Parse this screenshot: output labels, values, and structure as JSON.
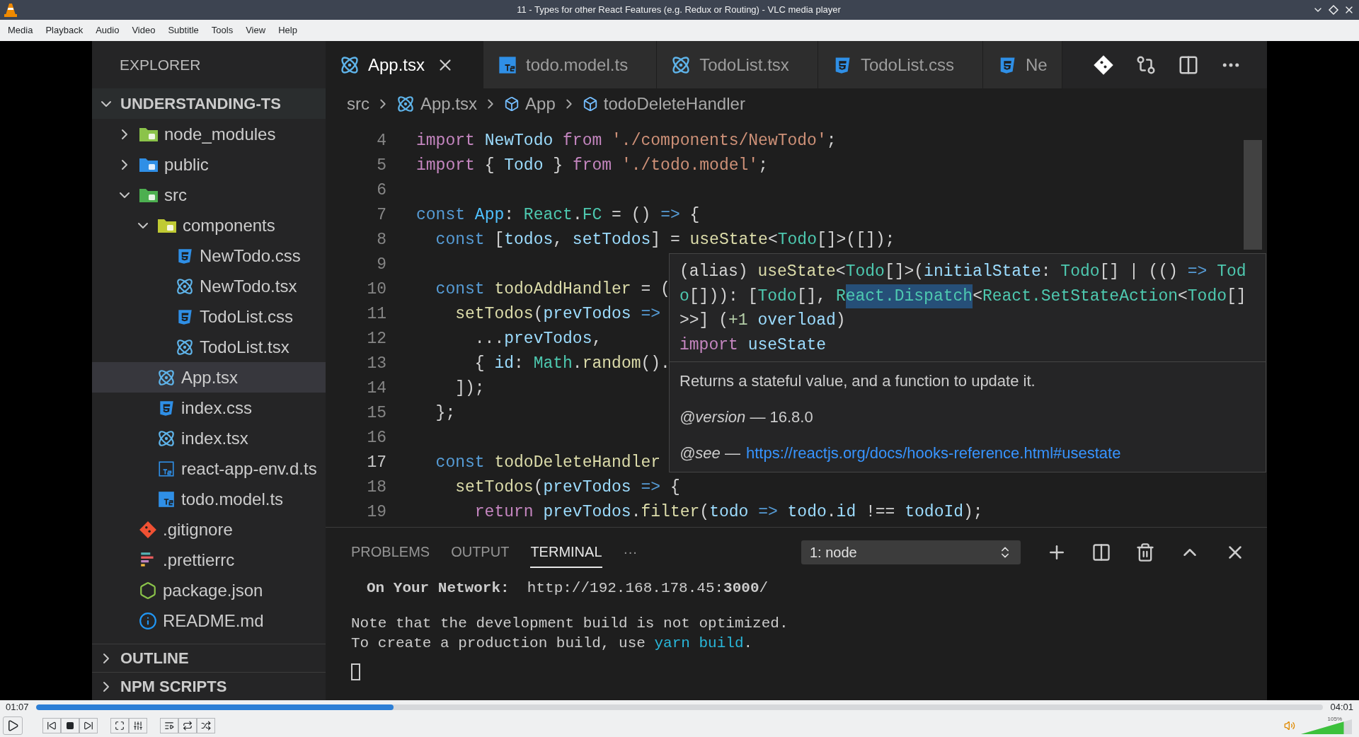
{
  "window": {
    "title": "11 - Types for other React Features (e.g. Redux or Routing) - VLC media player"
  },
  "menu": [
    "Media",
    "Playback",
    "Audio",
    "Video",
    "Subtitle",
    "Tools",
    "View",
    "Help"
  ],
  "editor": {
    "sidebar": {
      "title": "EXPLORER",
      "tree": [
        {
          "label": "UNDERSTANDING-TS",
          "kind": "root",
          "expanded": true,
          "selected": false,
          "children": [
            {
              "label": "node_modules",
              "kind": "folder-node",
              "expanded": false,
              "selected": false
            },
            {
              "label": "public",
              "kind": "folder-public",
              "expanded": false,
              "selected": false
            },
            {
              "label": "src",
              "kind": "folder-src",
              "expanded": true,
              "selected": false,
              "children": [
                {
                  "label": "components",
                  "kind": "folder-components",
                  "expanded": true,
                  "selected": false,
                  "children": [
                    {
                      "label": "NewTodo.css",
                      "kind": "css",
                      "selected": false
                    },
                    {
                      "label": "NewTodo.tsx",
                      "kind": "react",
                      "selected": false
                    },
                    {
                      "label": "TodoList.css",
                      "kind": "css",
                      "selected": false
                    },
                    {
                      "label": "TodoList.tsx",
                      "kind": "react",
                      "selected": false
                    }
                  ]
                },
                {
                  "label": "App.tsx",
                  "kind": "react",
                  "selected": true
                },
                {
                  "label": "index.css",
                  "kind": "css",
                  "selected": false
                },
                {
                  "label": "index.tsx",
                  "kind": "react",
                  "selected": false
                },
                {
                  "label": "react-app-env.d.ts",
                  "kind": "ts-outline",
                  "selected": false
                },
                {
                  "label": "todo.model.ts",
                  "kind": "ts",
                  "selected": false
                }
              ]
            },
            {
              "label": ".gitignore",
              "kind": "git",
              "selected": false
            },
            {
              "label": ".prettierrc",
              "kind": "prettier",
              "selected": false
            },
            {
              "label": "package.json",
              "kind": "json",
              "selected": false
            },
            {
              "label": "README.md",
              "kind": "info",
              "selected": false
            }
          ]
        }
      ],
      "sections": [
        {
          "label": "OUTLINE",
          "expanded": false
        },
        {
          "label": "NPM SCRIPTS",
          "expanded": false
        }
      ]
    },
    "tabs": [
      {
        "label": "App.tsx",
        "kind": "react",
        "selected": true
      },
      {
        "label": "todo.model.ts",
        "kind": "ts",
        "selected": false
      },
      {
        "label": "TodoList.tsx",
        "kind": "react",
        "selected": false
      },
      {
        "label": "TodoList.css",
        "kind": "css",
        "selected": false
      },
      {
        "label": "Ne",
        "kind": "css",
        "selected": false
      }
    ],
    "breadcrumb": [
      {
        "label": "src",
        "kind": "folder"
      },
      {
        "label": "App.tsx",
        "kind": "react"
      },
      {
        "label": "App",
        "kind": "symbol"
      },
      {
        "label": "todoDeleteHandler",
        "kind": "symbol"
      }
    ],
    "code_lines": [
      {
        "number": "4",
        "current": false,
        "tokens": [
          {
            "kind": "keyword",
            "text": "import "
          },
          {
            "kind": "variable",
            "text": "NewTodo "
          },
          {
            "kind": "keyword",
            "text": "from "
          },
          {
            "kind": "string",
            "text": "'./components/NewTodo'"
          },
          {
            "kind": "plain",
            "text": ";"
          }
        ]
      },
      {
        "number": "5",
        "current": false,
        "tokens": [
          {
            "kind": "keyword",
            "text": "import "
          },
          {
            "kind": "plain",
            "text": "{ "
          },
          {
            "kind": "variable",
            "text": "Todo"
          },
          {
            "kind": "plain",
            "text": " } "
          },
          {
            "kind": "keyword",
            "text": "from "
          },
          {
            "kind": "string",
            "text": "'./todo.model'"
          },
          {
            "kind": "plain",
            "text": ";"
          }
        ]
      },
      {
        "number": "6",
        "current": false
      },
      {
        "number": "7",
        "current": false,
        "tokens": [
          {
            "kind": "storage",
            "text": "const "
          },
          {
            "kind": "constant",
            "text": "App"
          },
          {
            "kind": "plain",
            "text": ": "
          },
          {
            "kind": "type",
            "text": "React"
          },
          {
            "kind": "plain",
            "text": "."
          },
          {
            "kind": "type",
            "text": "FC"
          },
          {
            "kind": "plain",
            "text": " = () "
          },
          {
            "kind": "storage",
            "text": "=>"
          },
          {
            "kind": "plain",
            "text": " {"
          }
        ]
      },
      {
        "number": "8",
        "current": false,
        "tokens": [
          {
            "kind": "storage",
            "text": "  const "
          },
          {
            "kind": "plain",
            "text": "["
          },
          {
            "kind": "variable",
            "text": "todos"
          },
          {
            "kind": "plain",
            "text": ", "
          },
          {
            "kind": "variable",
            "text": "setTodos"
          },
          {
            "kind": "plain",
            "text": "] = "
          },
          {
            "kind": "function",
            "text": "useState"
          },
          {
            "kind": "plain",
            "text": "<"
          },
          {
            "kind": "type",
            "text": "Todo"
          },
          {
            "kind": "plain",
            "text": "[]>([]);"
          }
        ]
      },
      {
        "number": "9",
        "current": false
      },
      {
        "number": "10",
        "current": false,
        "tokens": [
          {
            "kind": "storage",
            "text": "  const "
          },
          {
            "kind": "function",
            "text": "todoAddHandler"
          },
          {
            "kind": "plain",
            "text": " = ("
          }
        ]
      },
      {
        "number": "11",
        "current": false,
        "tokens": [
          {
            "kind": "function",
            "text": "    setTodos"
          },
          {
            "kind": "plain",
            "text": "("
          },
          {
            "kind": "variable",
            "text": "prevTodos"
          },
          {
            "kind": "storage",
            "text": " =>"
          }
        ]
      },
      {
        "number": "12",
        "current": false,
        "tokens": [
          {
            "kind": "plain",
            "text": "      ..."
          },
          {
            "kind": "variable",
            "text": "prevTodos"
          },
          {
            "kind": "plain",
            "text": ","
          }
        ]
      },
      {
        "number": "13",
        "current": false,
        "tokens": [
          {
            "kind": "plain",
            "text": "      { "
          },
          {
            "kind": "variable",
            "text": "id"
          },
          {
            "kind": "plain",
            "text": ": "
          },
          {
            "kind": "type",
            "text": "Math"
          },
          {
            "kind": "plain",
            "text": "."
          },
          {
            "kind": "function",
            "text": "random"
          },
          {
            "kind": "plain",
            "text": "()."
          }
        ]
      },
      {
        "number": "14",
        "current": false,
        "tokens": [
          {
            "kind": "plain",
            "text": "    ]);"
          }
        ]
      },
      {
        "number": "15",
        "current": false,
        "tokens": [
          {
            "kind": "plain",
            "text": "  };"
          }
        ]
      },
      {
        "number": "16",
        "current": false
      },
      {
        "number": "17",
        "current": true,
        "tokens": [
          {
            "kind": "storage",
            "text": "  const "
          },
          {
            "kind": "function",
            "text": "todoDeleteHandler"
          }
        ]
      },
      {
        "number": "18",
        "current": false,
        "tokens": [
          {
            "kind": "function",
            "text": "    setTodos"
          },
          {
            "kind": "plain",
            "text": "("
          },
          {
            "kind": "variable",
            "text": "prevTodos"
          },
          {
            "kind": "storage",
            "text": " =>"
          },
          {
            "kind": "plain",
            "text": " {"
          }
        ]
      },
      {
        "number": "19",
        "current": false,
        "tokens": [
          {
            "kind": "keyword",
            "text": "      return "
          },
          {
            "kind": "variable",
            "text": "prevTodos"
          },
          {
            "kind": "plain",
            "text": "."
          },
          {
            "kind": "function",
            "text": "filter"
          },
          {
            "kind": "plain",
            "text": "("
          },
          {
            "kind": "variable",
            "text": "todo"
          },
          {
            "kind": "storage",
            "text": " =>"
          },
          {
            "kind": "variable",
            "text": " todo"
          },
          {
            "kind": "plain",
            "text": "."
          },
          {
            "kind": "variable",
            "text": "id"
          },
          {
            "kind": "plain",
            "text": " !== "
          },
          {
            "kind": "variable",
            "text": "todoId"
          },
          {
            "kind": "plain",
            "text": ");"
          }
        ]
      }
    ],
    "hover": {
      "signature_lines": [
        [
          {
            "kind": "plain",
            "text": "(alias) ",
            "highlighted": false
          },
          {
            "kind": "function",
            "text": "useState",
            "highlighted": false
          },
          {
            "kind": "plain",
            "text": "<",
            "highlighted": false
          },
          {
            "kind": "type",
            "text": "Todo",
            "highlighted": false
          },
          {
            "kind": "plain",
            "text": "[]>(",
            "highlighted": false
          },
          {
            "kind": "variable",
            "text": "initialState",
            "highlighted": false
          },
          {
            "kind": "plain",
            "text": ": ",
            "highlighted": false
          },
          {
            "kind": "type",
            "text": "Todo",
            "highlighted": false
          },
          {
            "kind": "plain",
            "text": "[] | (() ",
            "highlighted": false
          },
          {
            "kind": "storage",
            "text": "=>",
            "highlighted": false
          },
          {
            "kind": "type",
            "text": " Tod",
            "highlighted": false
          }
        ],
        [
          {
            "kind": "type",
            "text": "o",
            "highlighted": false
          },
          {
            "kind": "plain",
            "text": "[])): [",
            "highlighted": false
          },
          {
            "kind": "type",
            "text": "Todo",
            "highlighted": false
          },
          {
            "kind": "plain",
            "text": "[], ",
            "highlighted": false
          },
          {
            "kind": "type",
            "text": "R",
            "highlighted": false
          },
          {
            "kind": "type",
            "text": "eact.Dispatch",
            "highlighted": true
          },
          {
            "kind": "plain",
            "text": "<",
            "highlighted": false
          },
          {
            "kind": "type",
            "text": "React.SetStateAction",
            "highlighted": false
          },
          {
            "kind": "plain",
            "text": "<",
            "highlighted": false
          },
          {
            "kind": "type",
            "text": "Todo",
            "highlighted": false
          },
          {
            "kind": "plain",
            "text": "[]",
            "highlighted": false
          }
        ],
        [
          {
            "kind": "plain",
            "text": ">>] (",
            "highlighted": false
          },
          {
            "kind": "number",
            "text": "+1",
            "highlighted": false
          },
          {
            "kind": "variable",
            "text": " overload",
            "highlighted": false
          },
          {
            "kind": "plain",
            "text": ")",
            "highlighted": false
          }
        ],
        [
          {
            "kind": "keyword",
            "text": "import ",
            "highlighted": false
          },
          {
            "kind": "variable",
            "text": "useState",
            "highlighted": false
          }
        ]
      ],
      "description": "Returns a stateful value, and a function to update it.",
      "version": "*@version* — 16.8.0",
      "see_label": "*@see* —",
      "see_link": "https://reactjs.org/docs/hooks-reference.html#usestate"
    },
    "panel": {
      "tabs": [
        {
          "label": "PROBLEMS",
          "selected": false
        },
        {
          "label": "OUTPUT",
          "selected": false
        },
        {
          "label": "TERMINAL",
          "selected": true
        },
        {
          "label": "···",
          "selected": false
        }
      ],
      "terminal_select": "1: node",
      "terminal": {
        "network_line": "**On Your Network:**  http://192.168.178.45:**3000**/",
        "note_line": "Note that the development build is not optimized.",
        "build_line": {
          "before": "To create a production build, use ",
          "command": "yarn build",
          "after": "."
        }
      }
    }
  },
  "player": {
    "elapsed": "01:07",
    "total": "04:01",
    "progress": {
      "level": 0.278
    },
    "volume": {
      "label": "105%",
      "level": 0.84
    }
  }
}
